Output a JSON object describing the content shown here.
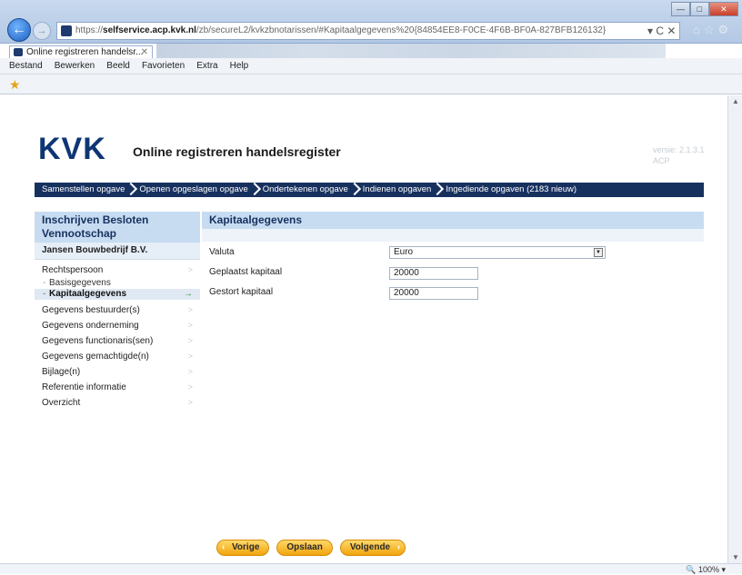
{
  "browser": {
    "url_prefix": "https://",
    "url_host": "selfservice.acp.kvk.nl",
    "url_path": "/zb/secureL2/kvkzbnotarissen/#Kapitaalgegevens%20{84854EE8-F0CE-4F6B-BF0A-827BFB126132}",
    "addr_buttons": "▾ C ✕",
    "tab_title": "Online registreren handelsr...",
    "tab_close": "✕",
    "menu": [
      "Bestand",
      "Bewerken",
      "Beeld",
      "Favorieten",
      "Extra",
      "Help"
    ],
    "zoom": "100%"
  },
  "header": {
    "logo": "KVK",
    "title": "Online registreren handelsregister",
    "version_line1": "versie: 2.1.3.1",
    "version_line2": "ACP"
  },
  "steps": [
    "Samenstellen opgave",
    "Openen opgeslagen opgave",
    "Ondertekenen opgave",
    "Indienen opgaven",
    "Ingediende opgaven (2183 nieuw)"
  ],
  "sidebar": {
    "heading_line1": "Inschrijven Besloten",
    "heading_line2": "Vennootschap",
    "company": "Jansen Bouwbedrijf B.V.",
    "items": [
      {
        "label": "Rechtspersoon"
      },
      {
        "label": "Basisgegevens",
        "sub": true
      },
      {
        "label": "Kapitaalgegevens",
        "sub": true,
        "active": true
      },
      {
        "label": "Gegevens bestuurder(s)"
      },
      {
        "label": "Gegevens onderneming"
      },
      {
        "label": "Gegevens functionaris(sen)"
      },
      {
        "label": "Gegevens gemachtigde(n)"
      },
      {
        "label": "Bijlage(n)"
      },
      {
        "label": "Referentie informatie"
      },
      {
        "label": "Overzicht"
      }
    ]
  },
  "main": {
    "heading": "Kapitaalgegevens",
    "fields": {
      "valuta_label": "Valuta",
      "valuta_value": "Euro",
      "geplaatst_label": "Geplaatst kapitaal",
      "geplaatst_value": "20000",
      "gestort_label": "Gestort kapitaal",
      "gestort_value": "20000"
    }
  },
  "buttons": {
    "prev": "Vorige",
    "save": "Opslaan",
    "next": "Volgende"
  },
  "colors": {
    "brand_navy": "#17315f",
    "section_header": "#c7dcf1",
    "button_orange": "#f1a40c"
  }
}
